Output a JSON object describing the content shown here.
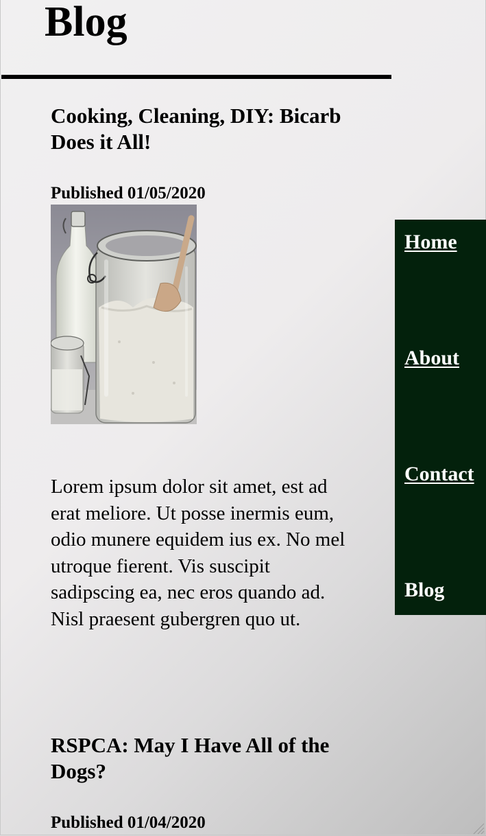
{
  "header": {
    "title": "Blog"
  },
  "nav": {
    "items": [
      {
        "label": "Home"
      },
      {
        "label": "About"
      },
      {
        "label": "Contact"
      },
      {
        "label": "Blog"
      }
    ]
  },
  "posts": [
    {
      "title": "Cooking, Cleaning, DIY: Bicarb Does it All!",
      "published": "Published 01/05/2020",
      "image_subject": "glass jars of bicarbonate of soda and a milk bottle",
      "body": "Lorem ipsum dolor sit amet, est ad erat meliore. Ut posse inermis eum, odio munere equidem ius ex. No mel utroque fierent. Vis suscipit sadipscing ea, nec eros quando ad. Nisl praesent gubergren quo ut."
    },
    {
      "title": "RSPCA: May I Have All of the Dogs?",
      "published": "Published 01/04/2020"
    }
  ],
  "colors": {
    "nav_background": "#03210c",
    "nav_text": "#ffffff",
    "rule": "#000000"
  }
}
